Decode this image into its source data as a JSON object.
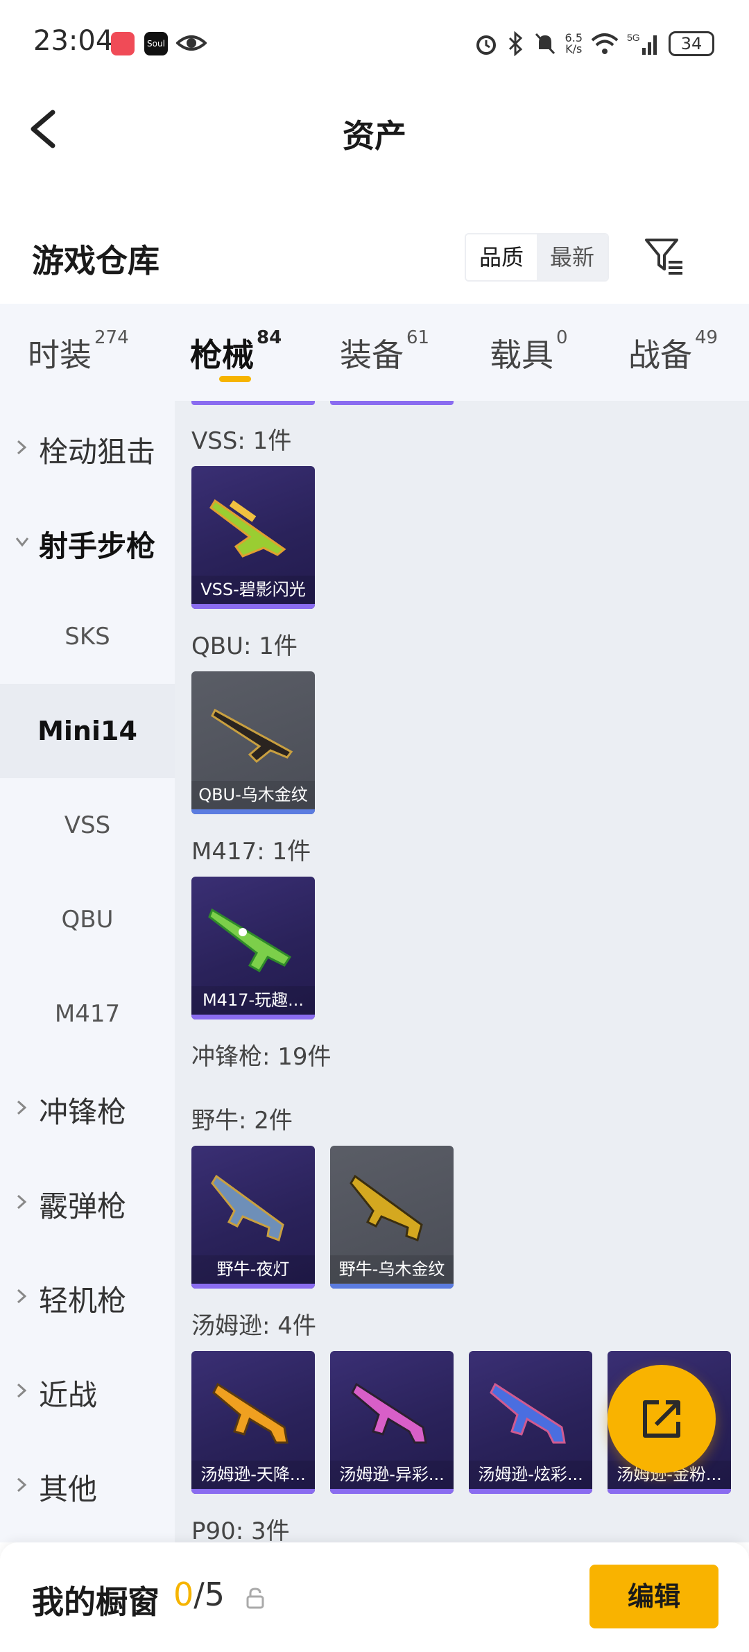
{
  "status": {
    "time": "23:04",
    "app_badge": "Soul",
    "speed": "6.5\nK/s",
    "battery": "34"
  },
  "header": {
    "title": "资产"
  },
  "warehouse": {
    "title": "游戏仓库",
    "sort_options": [
      "品质",
      "最新"
    ],
    "active_sort": "品质"
  },
  "categories": [
    {
      "label": "时装",
      "count": "274"
    },
    {
      "label": "枪械",
      "count": "84",
      "active": true
    },
    {
      "label": "装备",
      "count": "61"
    },
    {
      "label": "载具",
      "count": "0"
    },
    {
      "label": "战备",
      "count": "49"
    }
  ],
  "sidebar": {
    "items": [
      {
        "label": "栓动狙击"
      },
      {
        "label": "射手步枪"
      },
      {
        "label": "冲锋枪"
      },
      {
        "label": "霰弹枪"
      },
      {
        "label": "轻机枪"
      },
      {
        "label": "近战"
      },
      {
        "label": "其他"
      }
    ],
    "subitems": [
      "SKS",
      "Mini14",
      "VSS",
      "QBU",
      "M417"
    ],
    "selected_sub": "Mini14"
  },
  "content": {
    "groups": [
      {
        "label": "VSS: 1件",
        "cards": [
          "VSS-碧影闪光"
        ]
      },
      {
        "label": "QBU: 1件",
        "cards": [
          "QBU-乌木金纹"
        ]
      },
      {
        "label": "M417: 1件",
        "cards": [
          "M417-玩趣..."
        ]
      },
      {
        "label": "冲锋枪: 19件"
      },
      {
        "label": "野牛: 2件",
        "cards": [
          "野牛-夜灯",
          "野牛-乌木金纹"
        ]
      },
      {
        "label": "汤姆逊: 4件",
        "cards": [
          "汤姆逊-天降...",
          "汤姆逊-异彩...",
          "汤姆逊-炫彩...",
          "汤姆逊-金粉..."
        ]
      },
      {
        "label": "P90: 3件"
      }
    ]
  },
  "bottom": {
    "label": "我的橱窗",
    "count_current": "0",
    "count_total": "/5",
    "edit_label": "编辑"
  },
  "colors": {
    "accent": "#f9b300",
    "card_purple": "#2a225a",
    "card_gray": "#4a4d56",
    "rarity_purple": "#8a6cf0"
  }
}
